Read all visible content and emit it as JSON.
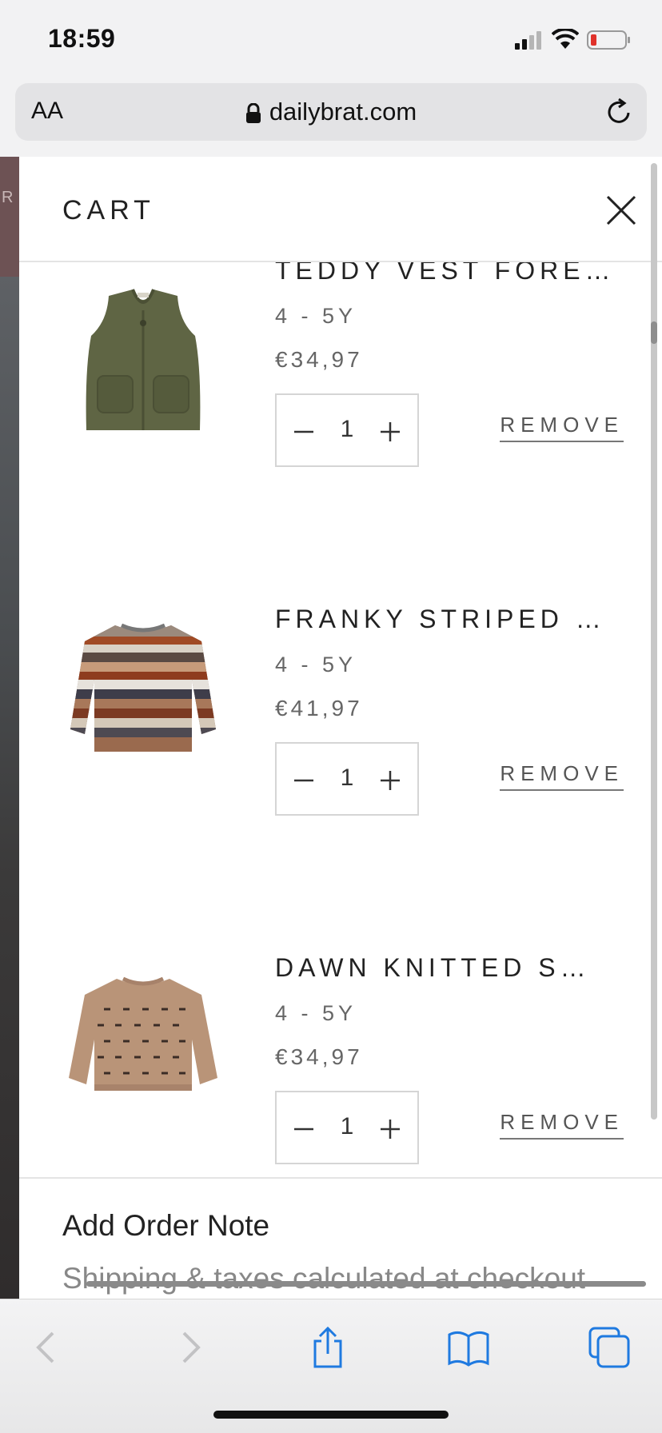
{
  "status_bar": {
    "time": "18:59",
    "icons": [
      "cellular-signal-icon",
      "wifi-icon",
      "battery-low-icon"
    ]
  },
  "address_bar": {
    "text_size_label": "AA",
    "url": "dailybrat.com",
    "icons": [
      "lock-icon",
      "reload-icon"
    ]
  },
  "page_edge_letter": "R",
  "cart": {
    "title": "CART",
    "close_icon": "close-icon",
    "items": [
      {
        "name": "TEDDY VEST FORE…",
        "size": "4 - 5Y",
        "price": "€34,97",
        "quantity": "1",
        "remove_label": "REMOVE",
        "image": "olive-teddy-vest"
      },
      {
        "name": "FRANKY STRIPED …",
        "size": "4 - 5Y",
        "price": "€41,97",
        "quantity": "1",
        "remove_label": "REMOVE",
        "image": "striped-knit-sweater"
      },
      {
        "name": "DAWN KNITTED S…",
        "size": "4 - 5Y",
        "price": "€34,97",
        "quantity": "1",
        "remove_label": "REMOVE",
        "image": "beige-knitted-sweater"
      }
    ],
    "footer": {
      "order_note": "Add Order Note",
      "shipping_note": "Shipping & taxes calculated at checkout"
    }
  },
  "toolbar": {
    "buttons": [
      "back-icon",
      "forward-icon",
      "share-icon",
      "bookmarks-icon",
      "tabs-icon"
    ]
  },
  "colors": {
    "vest": "#5f6544",
    "sweater_beige": "#b99478",
    "accent_blue": "#1f7ae0"
  }
}
